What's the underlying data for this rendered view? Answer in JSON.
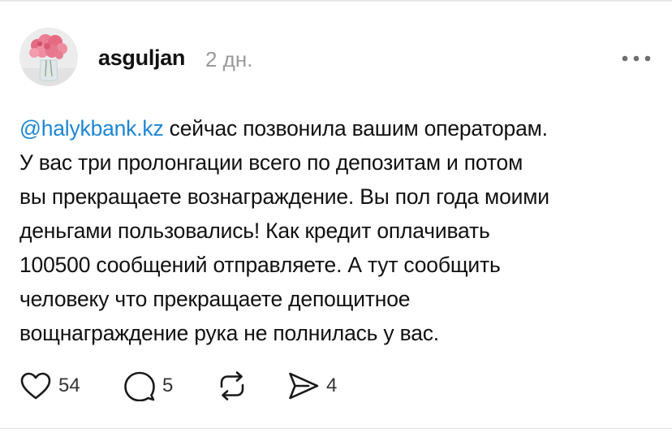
{
  "post": {
    "author": {
      "username": "asguljan",
      "time": "2 дн."
    },
    "text": {
      "mention": "@halykbank.kz",
      "line1_rest": " сейчас позвонила вашим операторам.",
      "line2": "У вас три пролонгации всего по депозитам и потом",
      "line3": "вы прекращаете вознаграждение. Вы пол года моими",
      "line4": "деньгами пользовались! Как кредит оплачивать",
      "line5": "100500 сообщений отправляете. А тут сообщить",
      "line6": "человеку что прекращаете депощитное",
      "line7": "вощнаграждение рука не полнилась у вас."
    },
    "actions": {
      "likes": "54",
      "replies": "5",
      "shares": "4"
    }
  },
  "colors": {
    "mention": "#1e86d6",
    "secondary_text": "#9a9a9a",
    "icon": "#1a1a1a"
  },
  "icons": [
    "heart-icon",
    "reply-bubble-icon",
    "repost-icon",
    "share-send-icon",
    "more-options-icon"
  ]
}
